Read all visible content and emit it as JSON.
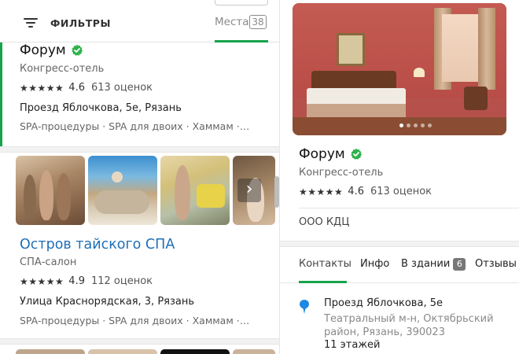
{
  "left_panel": {
    "filter_label": "ФИЛЬТРЫ",
    "places_label": "Места",
    "places_count": "38",
    "results": [
      {
        "title": "Форум",
        "verified": true,
        "category": "Конгресс-отель",
        "stars": "★★★★★",
        "rating": "4.6",
        "reviews": "613 оценок",
        "address": "Проезд Яблочкова, 5е, Рязань",
        "tags": "SPA-процедуры · SPA для двоих · Хаммам ·…"
      },
      {
        "title": "Остров тайского СПА",
        "verified": false,
        "category": "СПА-салон",
        "stars": "★★★★★",
        "rating": "4.9",
        "reviews": "112 оценок",
        "address": "Улица Краснорядская, 3, Рязань",
        "tags": "SPA-процедуры · SPA для двоих · Хаммам ·…"
      }
    ],
    "next_arrow": "›"
  },
  "detail_panel": {
    "title": "Форум",
    "verified": true,
    "category": "Конгресс-отель",
    "stars": "★★★★★",
    "rating": "4.6",
    "reviews": "613 оценок",
    "owner": "ООО КДЦ",
    "tabs": [
      {
        "label": "Контакты",
        "active": true
      },
      {
        "label": "Инфо",
        "active": false
      },
      {
        "label": "В здании",
        "badge": "6",
        "active": false
      },
      {
        "label": "Отзывы",
        "active": false
      }
    ],
    "address": {
      "main": "Проезд Яблочкова, 5е",
      "district": "Театральный м-н, Октябрьский район, Рязань, 390023",
      "floors": "11 этажей"
    }
  },
  "colors": {
    "accent_green": "#16a34a",
    "link_blue": "#1e6fb8",
    "pin_blue": "#1e88e5"
  }
}
